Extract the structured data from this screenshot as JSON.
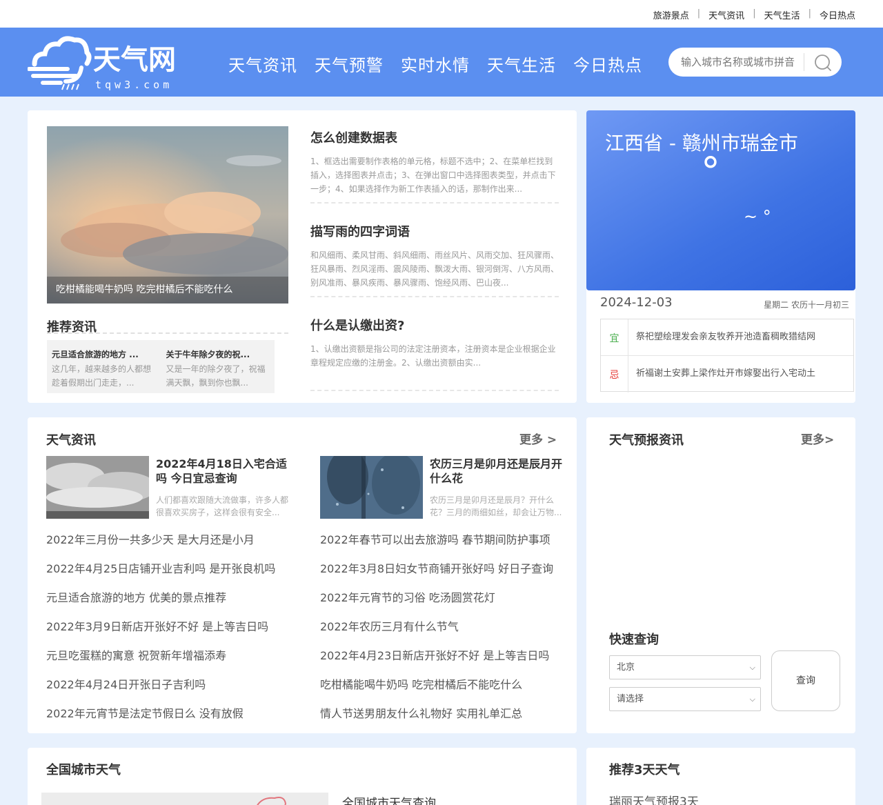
{
  "top_links": [
    "旅游景点",
    "天气资讯",
    "天气生活",
    "今日热点"
  ],
  "top_separator": "|",
  "logo": {
    "name": "天气网",
    "domain": "tqw3.com"
  },
  "nav": [
    "天气资讯",
    "天气预警",
    "实时水情",
    "天气生活",
    "今日热点"
  ],
  "search": {
    "placeholder": "输入城市名称或城市拼音"
  },
  "featured": {
    "hero_caption": "吃柑橘能喝牛奶吗 吃完柑橘后不能吃什么",
    "recommended_title": "推荐资讯",
    "recommended": [
      {
        "title": "元旦适合旅游的地方 ...",
        "desc": "这几年，越来越多的人都想趁着假期出门走走，..."
      },
      {
        "title": "关于牛年除夕夜的祝...",
        "desc": "又是一年的除夕夜了，祝福满天飘，飘到你也飘..."
      }
    ],
    "articles": [
      {
        "title": "怎么创建数据表",
        "desc": "1、框选出需要制作表格的单元格，标题不选中；2、在菜单栏找到插入，选择图表并点击；3、在弹出窗口中选择图表类型，并点击下一步；4、如果选择作为新工作表插入的话，那制作出来..."
      },
      {
        "title": "描写雨的四字词语",
        "desc": "和风细雨、柔风甘雨、斜风细雨、雨丝风片、风雨交加、狂风骤雨、狂风暴雨、烈风淫雨、震风陵雨、飘泼大雨、银河倒泻、八方风雨、别风准雨、暴风疾雨、暴风骤雨、饱经风雨、巴山夜..."
      },
      {
        "title": "什么是认缴出资?",
        "desc": "1、认缴出资额是指公司的法定注册资本，注册资本是企业根据企业章程规定应缴的注册金。2、认缴出资额由实..."
      }
    ]
  },
  "weather": {
    "location": "江西省 - 赣州市瑞金市",
    "temp_symbol": "°",
    "range_symbol": "~ °",
    "date": "2024-12-03",
    "lunar": "星期二  农历十一月初三",
    "yi_label": "宜",
    "yi": "祭祀塑绘理发会亲友牧养开池造畜稠畋猎结网",
    "ji_label": "忌",
    "ji": "祈福谢土安葬上梁作灶开市嫁娶出行入宅动土",
    "colors": {
      "yi": "#4caf50",
      "ji": "#e53935"
    }
  },
  "news": {
    "title": "天气资讯",
    "more": "更多 >",
    "top": [
      {
        "title": "2022年4月18日入宅合适吗 今日宜忌查询",
        "desc": "人们都喜欢跟随大流做事，许多人都很喜欢买房子，这样会很有安全..."
      },
      {
        "title": "农历三月是卯月还是辰月开什么花",
        "desc": "农历三月是卯月还是辰月？开什么花？三月的雨细如丝，却会让万物..."
      }
    ],
    "left_list": [
      "2022年三月份一共多少天 是大月还是小月",
      "2022年4月25日店铺开业吉利吗 是开张良机吗",
      "元旦适合旅游的地方 优美的景点推荐",
      "2022年3月9日新店开张好不好 是上等吉日吗",
      "元旦吃蛋糕的寓意 祝贺新年增福添寿",
      "2022年4月24日开张日子吉利吗",
      "2022年元宵节是法定节假日么 没有放假"
    ],
    "right_list": [
      "2022年春节可以出去旅游吗 春节期间防护事项",
      "2022年3月8日妇女节商铺开张好吗 好日子查询",
      "2022年元宵节的习俗 吃汤圆赏花灯",
      "2022年农历三月有什么节气",
      "2022年4月23日新店开张好不好 是上等吉日吗",
      "吃柑橘能喝牛奶吗 吃完柑橘后不能吃什么",
      "情人节送男朋友什么礼物好 实用礼单汇总"
    ]
  },
  "forecast": {
    "title": "天气预报资讯",
    "more": "更多>",
    "quick_title": "快速查询",
    "province": "北京",
    "city": "请选择",
    "button": "查询"
  },
  "national": {
    "title": "全国城市天气",
    "link": "全国城市天气查询"
  },
  "recommend3": {
    "title": "推荐3天天气",
    "item": "瑞丽天气预报3天"
  }
}
